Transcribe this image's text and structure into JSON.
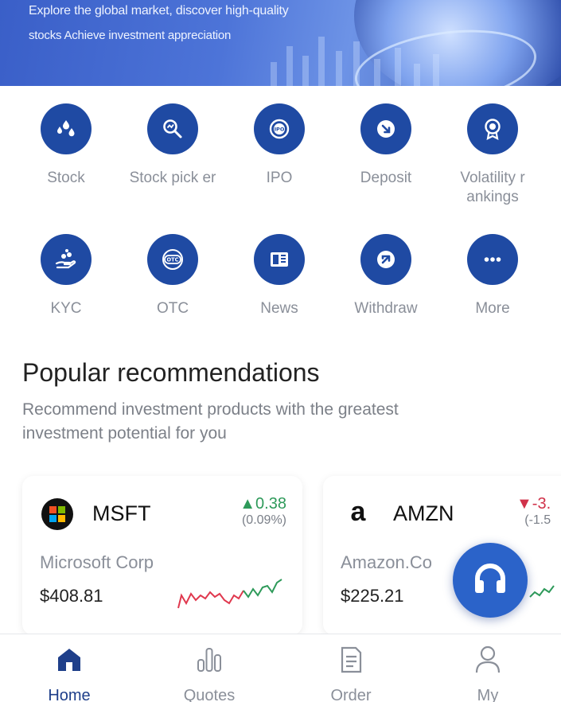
{
  "banner": {
    "line1": "Explore the global market, discover high-quality",
    "line2": "stocks Achieve investment appreciation"
  },
  "features": [
    {
      "label": "Stock",
      "icon": "stock-drops-icon"
    },
    {
      "label": "Stock pick er",
      "icon": "stock-picker-icon"
    },
    {
      "label": "IPO",
      "icon": "ipo-icon"
    },
    {
      "label": "Deposit",
      "icon": "deposit-icon"
    },
    {
      "label": "Volatility r ankings",
      "icon": "medal-icon"
    },
    {
      "label": "KYC",
      "icon": "kyc-hand-icon"
    },
    {
      "label": "OTC",
      "icon": "otc-icon"
    },
    {
      "label": "News",
      "icon": "news-icon"
    },
    {
      "label": "Withdraw",
      "icon": "withdraw-icon"
    },
    {
      "label": "More",
      "icon": "more-dots-icon"
    }
  ],
  "section": {
    "title": "Popular recommendations",
    "subtitle": "Recommend investment products with the greatest investment potential for you"
  },
  "cards": [
    {
      "ticker": "MSFT",
      "change": "▲0.38",
      "change_pct": "(0.09%)",
      "company": "Microsoft Corp",
      "price": "$408.81",
      "direction": "up"
    },
    {
      "ticker": "AMZN",
      "change": "▼-3.",
      "change_pct": "(-1.5",
      "company": "Amazon.Co",
      "price": "$225.21",
      "direction": "down"
    }
  ],
  "nav": [
    {
      "label": "Home",
      "icon": "home-icon",
      "active": true
    },
    {
      "label": "Quotes",
      "icon": "bar-chart-icon",
      "active": false
    },
    {
      "label": "Order",
      "icon": "order-document-icon",
      "active": false
    },
    {
      "label": "My",
      "icon": "person-icon",
      "active": false
    }
  ],
  "colors": {
    "primary": "#1f4aa3",
    "up": "#2e9a5a",
    "down": "#d0324a",
    "muted": "#8a8f99"
  }
}
